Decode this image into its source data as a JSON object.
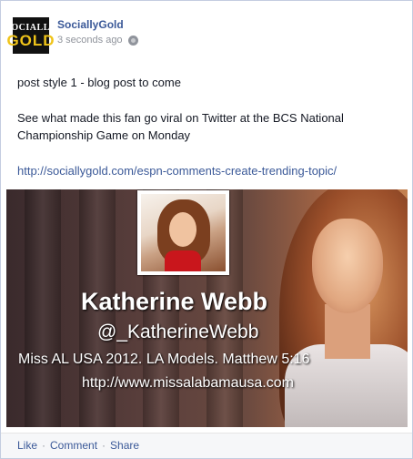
{
  "post": {
    "page_name": "SociallyGold",
    "timestamp": "3 seconds ago",
    "logo": {
      "line1": "SOCIALLY",
      "line2": "GOLD"
    },
    "privacy_icon": "globe-icon",
    "text_line1": "post style 1 - blog post to come",
    "text_line2": "See what made this fan go viral on Twitter at the BCS National Championship Game on Monday",
    "link": "http://sociallygold.com/espn-comments-create-trending-topic/"
  },
  "image": {
    "name": "Katherine Webb",
    "handle": "@_KatherineWebb",
    "bio": "Miss AL USA 2012. LA Models. Matthew 5:16",
    "url": "http://www.missalabamausa.com"
  },
  "actions": {
    "like": "Like",
    "comment": "Comment",
    "share": "Share",
    "separator": "·"
  },
  "colors": {
    "link": "#3b5998",
    "logo_gold": "#f0c419",
    "background": "#f2f3f5"
  }
}
